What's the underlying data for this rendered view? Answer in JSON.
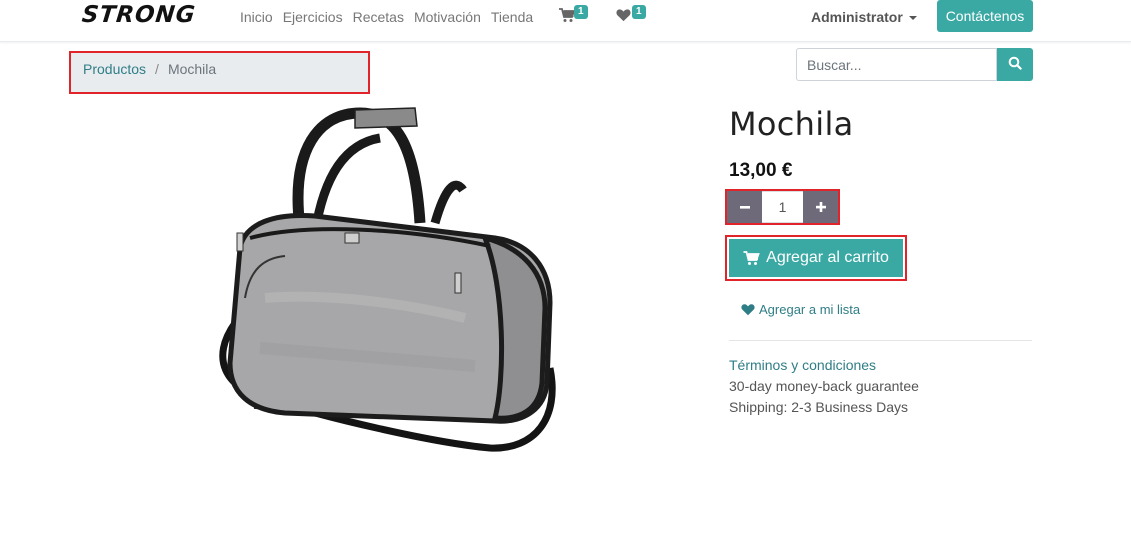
{
  "brand": {
    "logo": "STRONG"
  },
  "nav": {
    "links": [
      "Inicio",
      "Ejercicios",
      "Recetas",
      "Motivación",
      "Tienda"
    ],
    "cart_count": "1",
    "wishlist_count": "1",
    "user": "Administrator",
    "contact": "Contáctenos"
  },
  "breadcrumb": {
    "parent": "Productos",
    "separator": "/",
    "current": "Mochila"
  },
  "search": {
    "placeholder": "Buscar...",
    "value": ""
  },
  "product": {
    "name": "Mochila",
    "price": "13,00 €",
    "quantity": "1",
    "add_to_cart": "Agregar al carrito",
    "add_to_wishlist": "Agregar a mi lista",
    "terms": "Términos y condiciones",
    "info": [
      "30-day money-back guarantee",
      "Shipping: 2-3 Business Days"
    ]
  },
  "colors": {
    "accent": "#3aa9a4",
    "link": "#2f7e86",
    "qty_button": "#6f6a7a",
    "highlight": "#e0242a"
  },
  "icons": [
    "cart-icon",
    "heart-icon",
    "caret-down-icon",
    "search-icon",
    "minus-icon",
    "plus-icon"
  ]
}
